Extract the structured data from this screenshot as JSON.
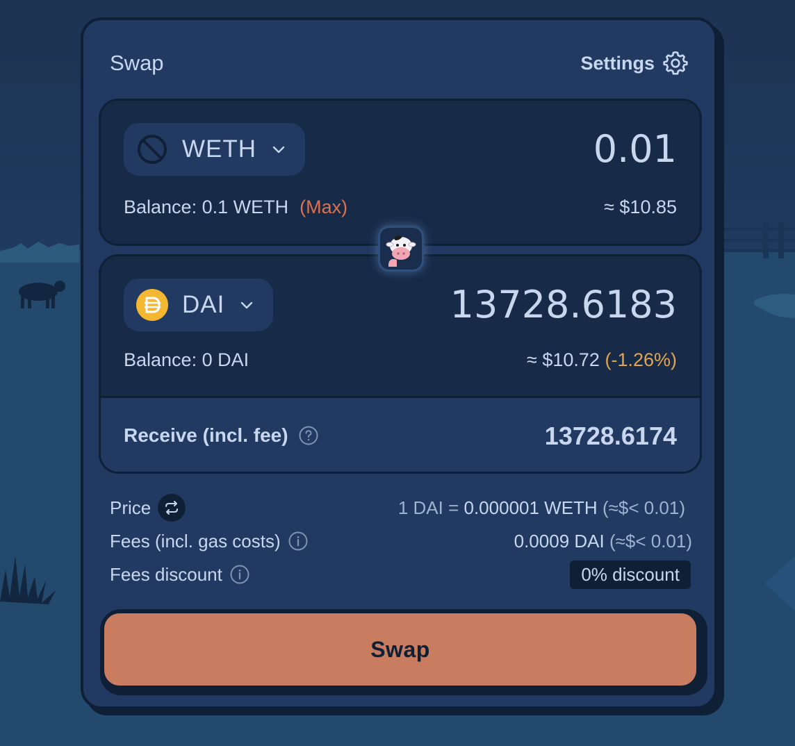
{
  "card": {
    "title": "Swap",
    "settings_label": "Settings"
  },
  "sell": {
    "token": "WETH",
    "amount": "0.01",
    "balance_text": "Balance: 0.1 WETH",
    "max_label": "(Max)",
    "usd_value": "≈ $10.85"
  },
  "buy": {
    "token": "DAI",
    "amount": "13728.6183",
    "balance_text": "Balance: 0 DAI",
    "usd_value": "≈ $10.72",
    "price_impact": "(-1.26%)",
    "receive_label": "Receive (incl. fee)",
    "receive_value": "13728.6174"
  },
  "details": {
    "price_label": "Price",
    "price_prefix": "1 DAI = ",
    "price_value": "0.000001 WETH",
    "price_usd": " (≈$< 0.01)",
    "fees_label": "Fees (incl. gas costs)",
    "fees_value": "0.0009 DAI",
    "fees_usd": " (≈$< 0.01)",
    "discount_label": "Fees discount",
    "discount_value": "0% discount"
  },
  "action": {
    "swap_label": "Swap"
  },
  "colors": {
    "card_bg": "#223a62",
    "panel_bg": "#172a48",
    "outline": "#0f1f36",
    "accent_orange": "#c97d60",
    "max_red": "#e0704c",
    "impact_amber": "#e3a64f",
    "dai_gold": "#f4b731"
  },
  "icons": [
    "gear-icon",
    "no-token-icon",
    "chevron-down-icon",
    "dai-logo-icon",
    "cow-mascot-icon",
    "question-icon",
    "swap-arrows-icon",
    "info-icon"
  ]
}
